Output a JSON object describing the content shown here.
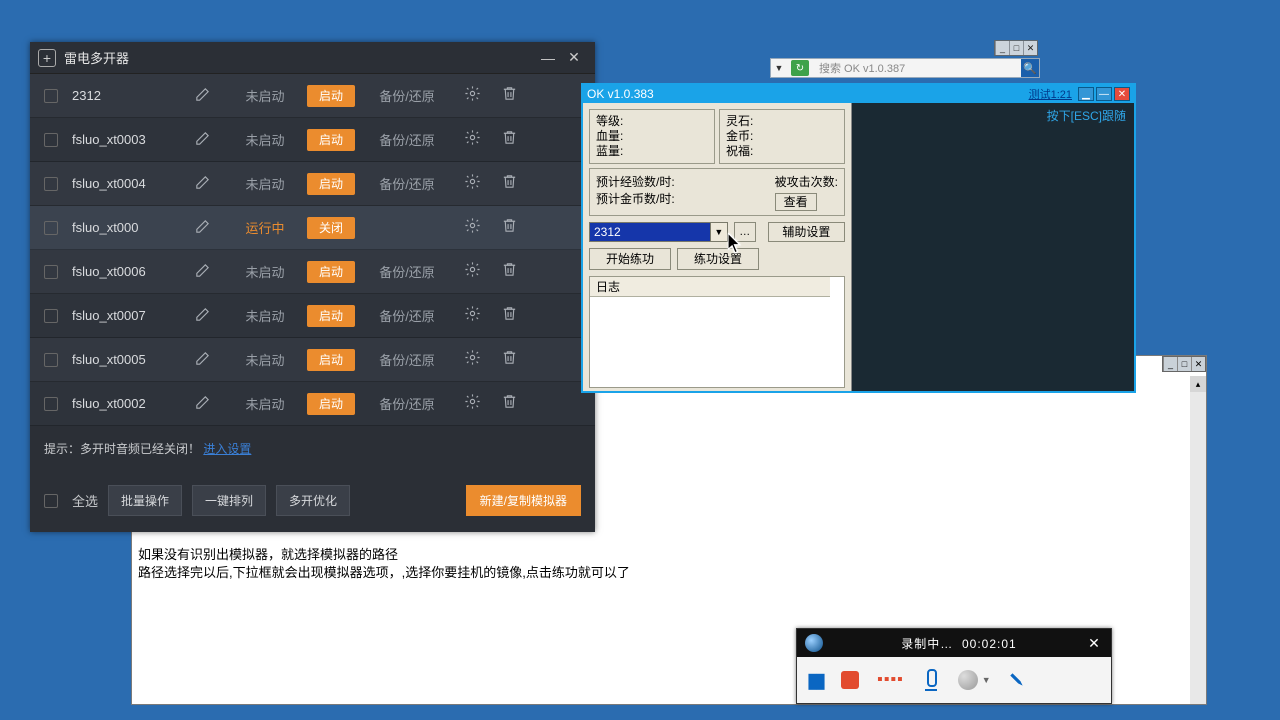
{
  "ld": {
    "title": "雷电多开器",
    "rows": [
      {
        "name": "2312",
        "status": "未启动",
        "action": "启动",
        "backup": "备份/还原",
        "running": false
      },
      {
        "name": "fsluo_xt0003",
        "status": "未启动",
        "action": "启动",
        "backup": "备份/还原",
        "running": false
      },
      {
        "name": "fsluo_xt0004",
        "status": "未启动",
        "action": "启动",
        "backup": "备份/还原",
        "running": false
      },
      {
        "name": "fsluo_xt000",
        "status": "运行中",
        "action": "关闭",
        "backup": "",
        "running": true
      },
      {
        "name": "fsluo_xt0006",
        "status": "未启动",
        "action": "启动",
        "backup": "备份/还原",
        "running": false
      },
      {
        "name": "fsluo_xt0007",
        "status": "未启动",
        "action": "启动",
        "backup": "备份/还原",
        "running": false
      },
      {
        "name": "fsluo_xt0005",
        "status": "未启动",
        "action": "启动",
        "backup": "备份/还原",
        "running": false
      },
      {
        "name": "fsluo_xt0002",
        "status": "未启动",
        "action": "启动",
        "backup": "备份/还原",
        "running": false
      }
    ],
    "tip_prefix": "提示：多开时音频已经关闭！",
    "tip_link": "进入设置",
    "select_all": "全选",
    "batch": "批量操作",
    "arrange": "一键排列",
    "optimize": "多开优化",
    "create": "新建/复制模拟器"
  },
  "browser": {
    "search_placeholder": "搜索 OK v1.0.387"
  },
  "ok": {
    "title": "OK v1.0.383",
    "test_link": "测试1:21",
    "esc_hint": "按下[ESC]跟随",
    "labels": {
      "level": "等级:",
      "hp": "血量:",
      "mp": "蓝量:",
      "spirit": "灵石:",
      "gold": "金币:",
      "bless": "祝福:",
      "exp_per": "预计经验数/时:",
      "gold_per": "预计金币数/时:",
      "attack_cnt": "被攻击次数:",
      "view": "查看",
      "aux_setting": "辅助设置",
      "start": "开始练功",
      "setting": "练功设置",
      "log": "日志"
    },
    "select_value": "2312"
  },
  "note": {
    "line1": "如果没有识别出模拟器，就选择模拟器的路径",
    "line2": "路径选择完以后,下拉框就会出现模拟器选项，,选择你要挂机的镜像,点击练功就可以了"
  },
  "recorder": {
    "status": "录制中…",
    "time": "00:02:01"
  }
}
